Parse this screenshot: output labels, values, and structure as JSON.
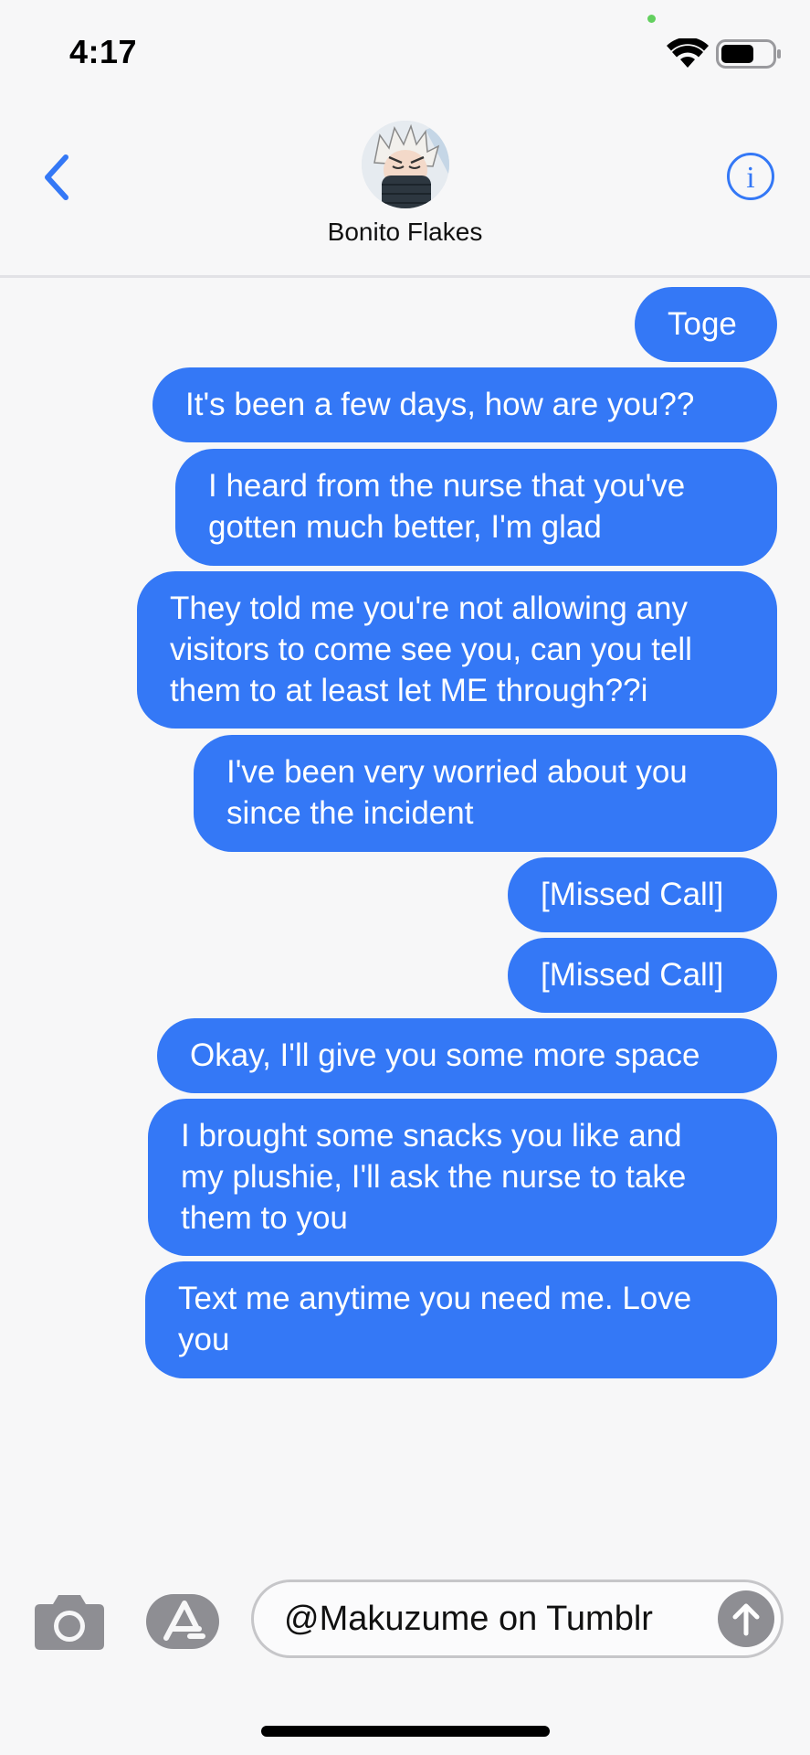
{
  "status_bar": {
    "time": "4:17",
    "wifi_icon": "wifi-icon",
    "battery_icon": "battery-icon",
    "privacy_dot_color": "#63d05f"
  },
  "header": {
    "back_icon": "chevron-left-icon",
    "contact_name": "Bonito Flakes",
    "avatar": "contact-avatar",
    "info_icon": "info-icon"
  },
  "accent_color": "#3478f6",
  "messages": [
    "Toge",
    "It's been a few days, how are you??",
    "I heard from the nurse that you've\ngotten much better, I'm glad",
    "They told me you're not allowing any\nvisitors to come see you, can you tell\nthem to at least let ME through??i",
    "I've been very worried about you\nsince the incident",
    "[Missed Call]",
    "[Missed Call]",
    "Okay, I'll give you some more space",
    "I brought some snacks you like and\nmy plushie, I'll ask the nurse to take\nthem to you",
    "Text me anytime you need me. Love\nyou"
  ],
  "composer": {
    "camera_icon": "camera-icon",
    "apps_icon": "app-store-icon",
    "message_text": "@Makuzume on Tumblr",
    "send_icon": "arrow-up-icon"
  }
}
